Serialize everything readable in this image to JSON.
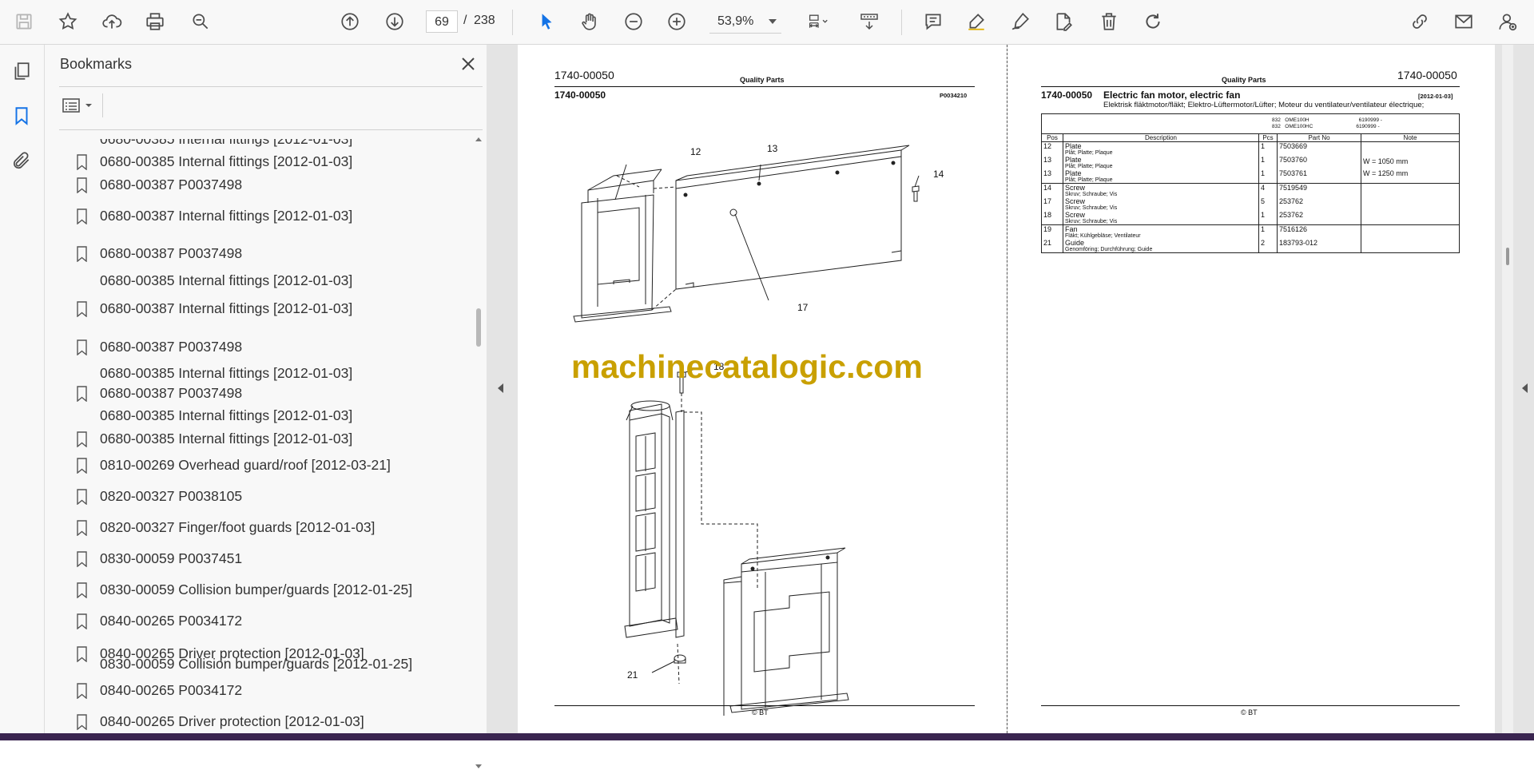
{
  "toolbar": {
    "page_current": "69",
    "page_separator": "/",
    "page_total": "238",
    "zoom": "53,9%"
  },
  "bookmarks": {
    "title": "Bookmarks",
    "items": [
      {
        "label": "0680-00385 Internal fittings [2012-01-03]"
      },
      {
        "label": "0680-00387 P0037498"
      },
      {
        "label": "0680-00387 Internal fittings [2012-01-03]"
      },
      {
        "label": "0680-00387 P0037498"
      },
      {
        "label": "0680-00385 Internal fittings [2012-01-03]"
      },
      {
        "label": "0680-00387 Internal fittings [2012-01-03]"
      },
      {
        "label": "0680-00387 P0037498"
      },
      {
        "label": "0680-00385 Internal fittings [2012-01-03]"
      },
      {
        "label": "0680-00387 P0037498"
      },
      {
        "label": "0680-00385 Internal fittings [2012-01-03]"
      },
      {
        "label": "0680-00385 Internal fittings [2012-01-03]"
      },
      {
        "label": "0810-00269 Overhead guard/roof [2012-03-21]"
      },
      {
        "label": "0820-00327 P0038105"
      },
      {
        "label": "0820-00327 Finger/foot guards [2012-01-03]"
      },
      {
        "label": "0830-00059 P0037451"
      },
      {
        "label": "0830-00059 Collision bumper/guards [2012-01-25]"
      },
      {
        "label": "0840-00265 P0034172"
      },
      {
        "label": "0840-00265 Driver protection [2012-01-03]"
      },
      {
        "label": "0830-00059 Collision bumper/guards [2012-01-25]"
      },
      {
        "label": "0840-00265 P0034172"
      },
      {
        "label": "0840-00265 Driver protection [2012-01-03]"
      }
    ]
  },
  "left_page": {
    "code_top": "1740-00050",
    "header": "Quality Parts",
    "code_sub": "1740-00050",
    "drawing_no": "P0034210",
    "callouts": [
      "12",
      "13",
      "14",
      "17",
      "18",
      "21"
    ],
    "footer": "© BT"
  },
  "right_page": {
    "header": "Quality Parts",
    "code_top": "1740-00050",
    "code_sub": "1740-00050",
    "title": "Electric fan motor, electric fan",
    "date": "[2012-01-03]",
    "subtitle": "Elektrisk fläktmotor/fläkt; Elektro-Lüftermotor/Lüfter; Moteur du ventilateur/ventilateur électrique;",
    "models": [
      {
        "a": "832",
        "b": "OME100H",
        "c": "6190999 -"
      },
      {
        "a": "832",
        "b": "OME100HC",
        "c": "6190999 -"
      }
    ],
    "columns": [
      "Pos",
      "Description",
      "Pcs",
      "Part No",
      "Note"
    ],
    "groups": [
      [
        {
          "pos": "12",
          "desc": "Plate",
          "sub": "Plåt; Platte; Plaque",
          "pcs": "1",
          "part": "7503669",
          "note": ""
        },
        {
          "pos": "13",
          "desc": "Plate",
          "sub": "Plåt; Platte; Plaque",
          "pcs": "1",
          "part": "7503760",
          "note": "W = 1050 mm"
        },
        {
          "pos": "13",
          "desc": "Plate",
          "sub": "Plåt; Platte; Plaque",
          "pcs": "1",
          "part": "7503761",
          "note": "W = 1250 mm"
        }
      ],
      [
        {
          "pos": "14",
          "desc": "Screw",
          "sub": "Skruv; Schraube; Vis",
          "pcs": "4",
          "part": "7519549",
          "note": ""
        },
        {
          "pos": "17",
          "desc": "Screw",
          "sub": "Skruv; Schraube; Vis",
          "pcs": "5",
          "part": "253762",
          "note": ""
        },
        {
          "pos": "18",
          "desc": "Screw",
          "sub": "Skruv; Schraube; Vis",
          "pcs": "1",
          "part": "253762",
          "note": ""
        }
      ],
      [
        {
          "pos": "19",
          "desc": "Fan",
          "sub": "Fläkt; Kühlgebläse; Ventilateur",
          "pcs": "1",
          "part": "7516126",
          "note": ""
        },
        {
          "pos": "21",
          "desc": "Guide",
          "sub": "Genomföring; Durchführung; Guide",
          "pcs": "2",
          "part": "183793-012",
          "note": ""
        }
      ]
    ],
    "footer": "© BT"
  },
  "watermark": "machinecatalogic.com"
}
